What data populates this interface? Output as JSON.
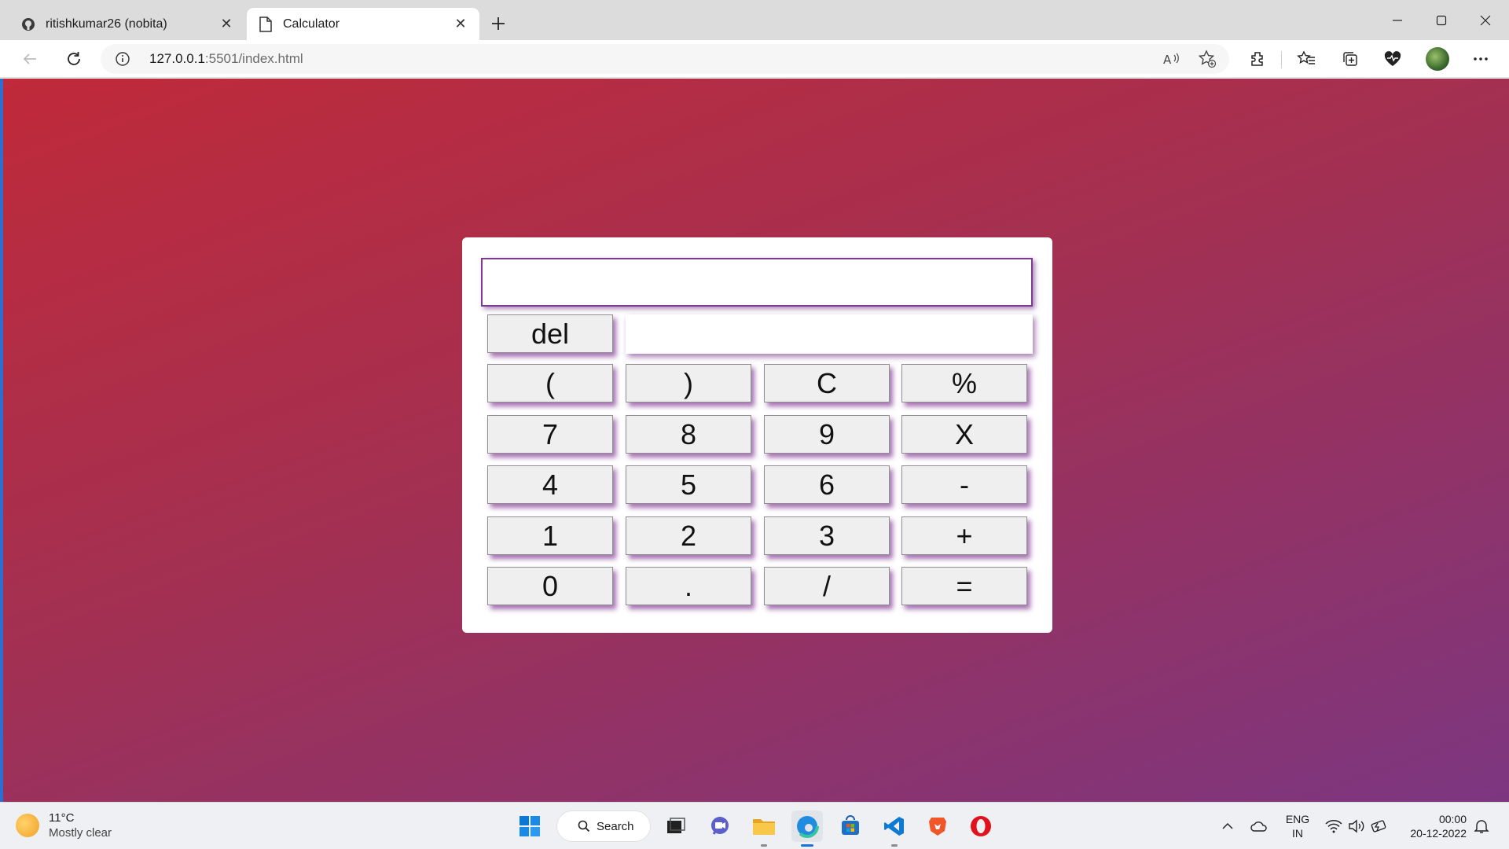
{
  "browser": {
    "tabs": [
      {
        "title": "ritishkumar26 (nobita)",
        "icon": "github-icon",
        "active": false
      },
      {
        "title": "Calculator",
        "icon": "page-icon",
        "active": true
      }
    ],
    "url": {
      "host": "127.0.0.1",
      "rest": ":5501/index.html"
    }
  },
  "calculator": {
    "display_value": "",
    "history_value": "",
    "del_label": "del",
    "keys": [
      [
        "(",
        ")",
        "C",
        "%"
      ],
      [
        "7",
        "8",
        "9",
        "X"
      ],
      [
        "4",
        "5",
        "6",
        "-"
      ],
      [
        "1",
        "2",
        "3",
        "+"
      ],
      [
        "0",
        ".",
        "/",
        "="
      ]
    ]
  },
  "taskbar": {
    "weather": {
      "temp": "11°C",
      "condition": "Mostly clear"
    },
    "search_label": "Search",
    "language": {
      "line1": "ENG",
      "line2": "IN"
    },
    "time": "00:00",
    "date": "20-12-2022"
  },
  "colors": {
    "background_start": "#c02a3a",
    "background_end": "#7c3680",
    "button_shadow": "#7b3b8f"
  }
}
